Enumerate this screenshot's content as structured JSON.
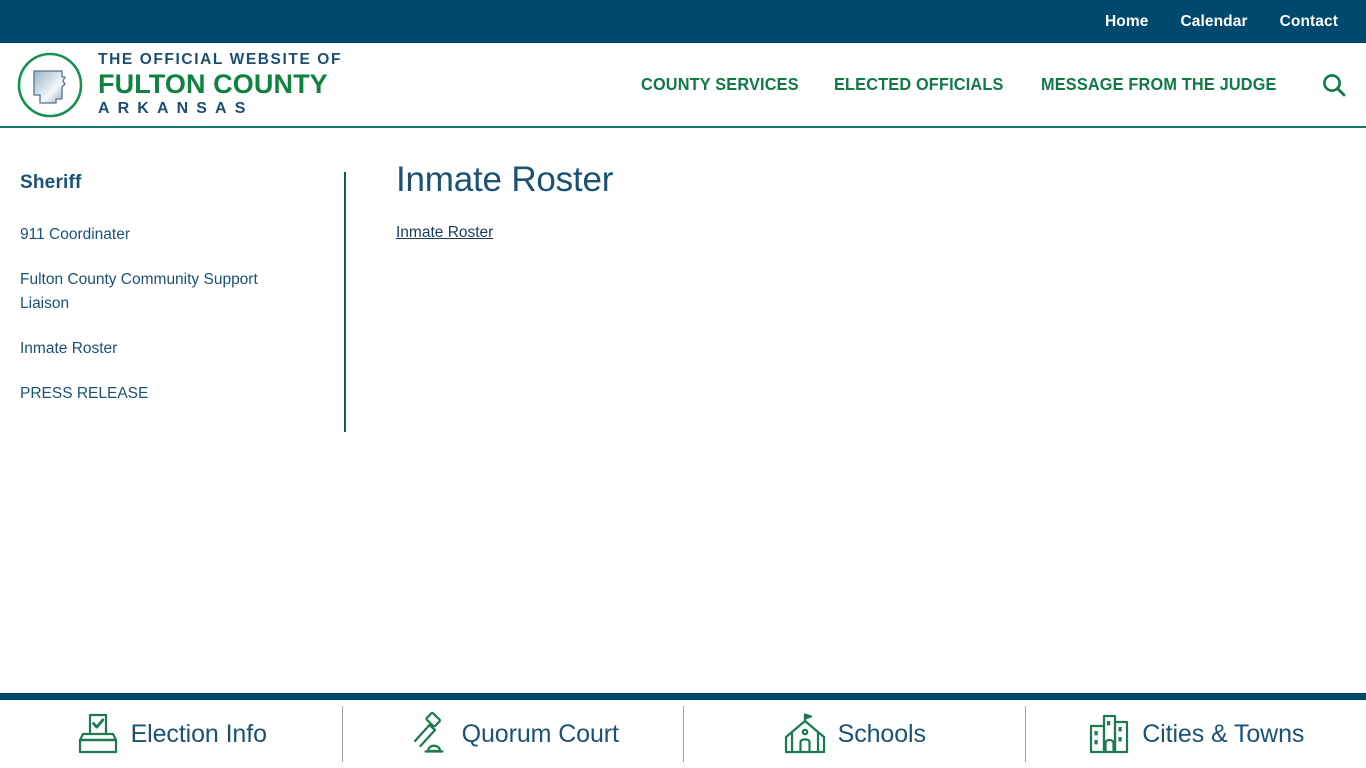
{
  "topbar": {
    "links": [
      {
        "label": "Home",
        "name": "topbar-link-home"
      },
      {
        "label": "Calendar",
        "name": "topbar-link-calendar"
      },
      {
        "label": "Contact",
        "name": "topbar-link-contact"
      }
    ]
  },
  "brand": {
    "line1": "THE OFFICIAL WEBSITE OF",
    "line2": "FULTON COUNTY",
    "line3": "ARKANSAS",
    "seal_icon": "arkansas-state-seal-icon"
  },
  "mainnav": {
    "links": [
      {
        "label": "COUNTY SERVICES"
      },
      {
        "label": "ELECTED OFFICIALS"
      },
      {
        "label": "MESSAGE FROM THE JUDGE"
      }
    ],
    "search_icon": "search-icon"
  },
  "sidebar": {
    "title": "Sheriff",
    "items": [
      {
        "label": "911 Coordinater"
      },
      {
        "label": "Fulton County Community Support Liaison"
      },
      {
        "label": "Inmate Roster"
      },
      {
        "label": "PRESS RELEASE"
      }
    ]
  },
  "main": {
    "title": "Inmate Roster",
    "link": "Inmate Roster"
  },
  "footer": {
    "items": [
      {
        "label": "Election Info",
        "icon": "ballot-box-icon"
      },
      {
        "label": "Quorum Court",
        "icon": "gavel-icon"
      },
      {
        "label": "Schools",
        "icon": "schoolhouse-icon"
      },
      {
        "label": "Cities & Towns",
        "icon": "buildings-icon"
      }
    ]
  },
  "colors": {
    "navy": "#00496e",
    "green": "#0f7a45",
    "teal_rule": "#0c7864",
    "link_blue": "#1a5276",
    "divider_gray": "#9aa5ab"
  }
}
